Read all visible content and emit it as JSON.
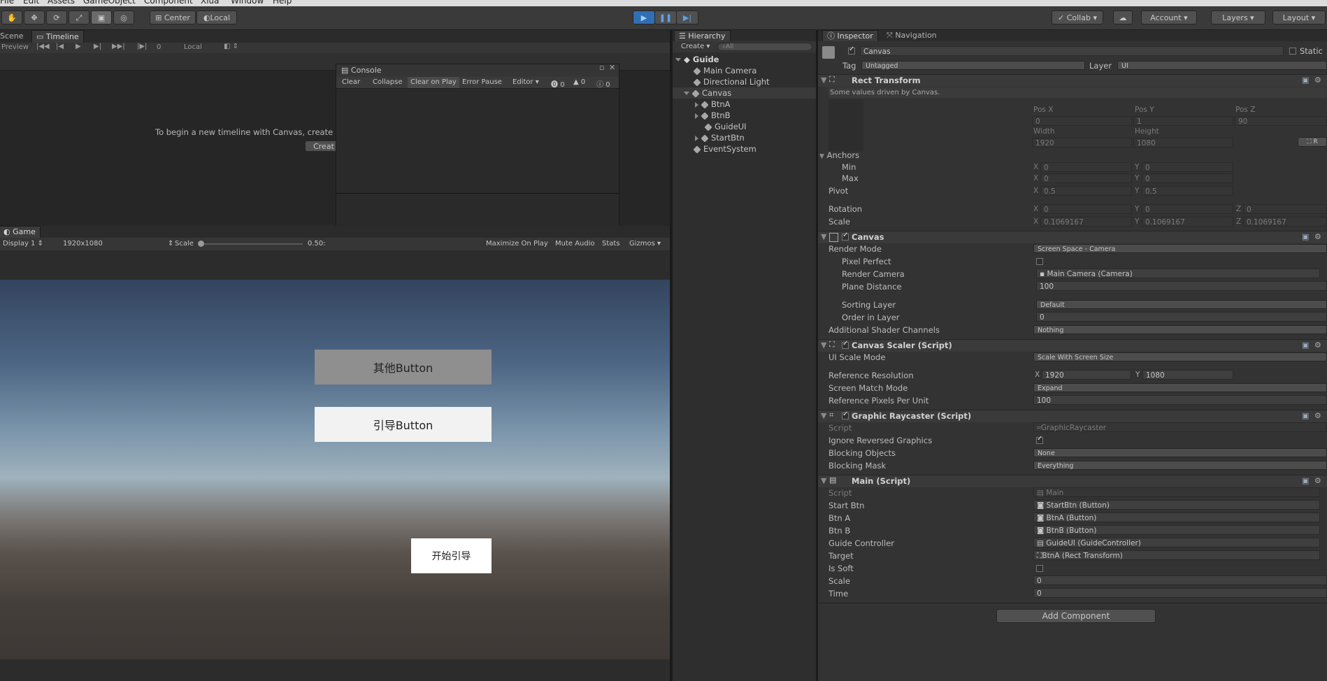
{
  "menu": [
    "File",
    "Edit",
    "Assets",
    "GameObject",
    "Component",
    "Xlua",
    "Window",
    "Help"
  ],
  "toolbar": {
    "center_label": "Center",
    "local_label": "Local",
    "collab_label": "Collab",
    "account_label": "Account",
    "layers_label": "Layers",
    "layout_label": "Layout"
  },
  "timeline": {
    "tabs": [
      "Scene",
      "Timeline"
    ],
    "preview_label": "Preview",
    "frame_value": "0",
    "local_label": "Local",
    "message": "To begin a new timeline with Canvas, create",
    "create_button": "Creat"
  },
  "console": {
    "title": "Console",
    "buttons": [
      "Clear",
      "Collapse",
      "Clear on Play",
      "Error Pause",
      "Editor"
    ],
    "counts": {
      "errors": "0",
      "warnings": "0",
      "messages": "0"
    }
  },
  "game": {
    "tab": "Game",
    "display": "Display 1",
    "resolution": "1920x1080",
    "scale_label": "Scale",
    "scale_value": "0.50:",
    "options": [
      "Maximize On Play",
      "Mute Audio",
      "Stats",
      "Gizmos"
    ],
    "buttons": {
      "other": "其他Button",
      "guide": "引导Button",
      "start": "开始引导"
    },
    "colors": {
      "other": "#8f8f8f",
      "guide": "#f2f2f2",
      "start": "#ffffff"
    }
  },
  "hierarchy": {
    "tab": "Hierarchy",
    "create_label": "Create",
    "search_placeholder": "All",
    "scene": "Guide",
    "items": [
      "Main Camera",
      "Directional Light",
      "Canvas",
      "BtnA",
      "BtnB",
      "GuideUI",
      "StartBtn",
      "EventSystem"
    ]
  },
  "inspector": {
    "tabs": [
      "Inspector",
      "Navigation"
    ],
    "object_name": "Canvas",
    "static_label": "Static",
    "tag_label": "Tag",
    "tag_value": "Untagged",
    "layer_label": "Layer",
    "layer_value": "UI",
    "rect_transform": {
      "title": "Rect Transform",
      "note": "Some values driven by Canvas.",
      "pos_labels": [
        "Pos X",
        "Pos Y",
        "Pos Z"
      ],
      "pos_values": [
        "0",
        "1",
        "90"
      ],
      "size_labels": [
        "Width",
        "Height"
      ],
      "size_values": [
        "1920",
        "1080"
      ],
      "anchors_label": "Anchors",
      "min_label": "Min",
      "max_label": "Max",
      "min_x": "0",
      "min_y": "0",
      "max_x": "0",
      "max_y": "0",
      "pivot_label": "Pivot",
      "pivot_x": "0.5",
      "pivot_y": "0.5",
      "rotation_label": "Rotation",
      "rot_x": "0",
      "rot_y": "0",
      "rot_z": "0",
      "scale_label": "Scale",
      "scale_x": "0.1069167",
      "scale_y": "0.1069167",
      "scale_z": "0.1069167"
    },
    "canvas": {
      "title": "Canvas",
      "render_mode_label": "Render Mode",
      "render_mode": "Screen Space - Camera",
      "pixel_perfect_label": "Pixel Perfect",
      "render_camera_label": "Render Camera",
      "render_camera": "Main Camera (Camera)",
      "plane_distance_label": "Plane Distance",
      "plane_distance": "100",
      "sorting_layer_label": "Sorting Layer",
      "sorting_layer": "Default",
      "order_label": "Order in Layer",
      "order": "0",
      "shader_label": "Additional Shader Channels",
      "shader": "Nothing"
    },
    "scaler": {
      "title": "Canvas Scaler (Script)",
      "mode_label": "UI Scale Mode",
      "mode": "Scale With Screen Size",
      "ref_res_label": "Reference Resolution",
      "ref_x": "1920",
      "ref_y": "1080",
      "match_label": "Screen Match Mode",
      "match": "Expand",
      "ppu_label": "Reference Pixels Per Unit",
      "ppu": "100"
    },
    "raycaster": {
      "title": "Graphic Raycaster (Script)",
      "script_label": "Script",
      "script": "GraphicRaycaster",
      "ignore_label": "Ignore Reversed Graphics",
      "blocking_objects_label": "Blocking Objects",
      "blocking_objects": "None",
      "blocking_mask_label": "Blocking Mask",
      "blocking_mask": "Everything"
    },
    "main_script": {
      "title": "Main (Script)",
      "script_label": "Script",
      "script": "Main",
      "start_btn_label": "Start Btn",
      "start_btn": "StartBtn (Button)",
      "btn_a_label": "Btn A",
      "btn_a": "BtnA (Button)",
      "btn_b_label": "Btn B",
      "btn_b": "BtnB (Button)",
      "guide_label": "Guide Controller",
      "guide": "GuideUI (GuideController)",
      "target_label": "Target",
      "target": "BtnA (Rect Transform)",
      "soft_label": "Is Soft",
      "scale_label": "Scale",
      "scale": "0",
      "time_label": "Time",
      "time": "0"
    },
    "add_component": "Add Component"
  }
}
